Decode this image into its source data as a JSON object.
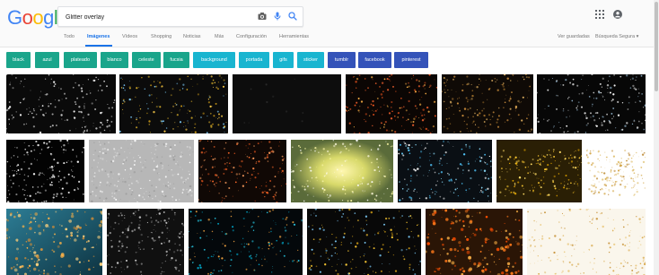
{
  "search": {
    "query": "Glitter overlay"
  },
  "logo": {
    "letters": [
      "G",
      "o",
      "o",
      "g",
      "l",
      "e"
    ],
    "colors": [
      "#4285F4",
      "#EA4335",
      "#FBBC05",
      "#4285F4",
      "#34A853",
      "#EA4335"
    ]
  },
  "tabs": [
    {
      "label": "Todo",
      "active": false
    },
    {
      "label": "Imágenes",
      "active": true
    },
    {
      "label": "Vídeos",
      "active": false
    },
    {
      "label": "Shopping",
      "active": false
    },
    {
      "label": "Noticias",
      "active": false
    },
    {
      "label": "Más",
      "active": false
    },
    {
      "label": "Configuración",
      "active": false
    },
    {
      "label": "Herramientas",
      "active": false
    }
  ],
  "right_tools": {
    "saved": "Ver guardadas",
    "safe": "Búsqueda Segura ▾"
  },
  "chips": [
    {
      "label": "black",
      "color": "#1aa58b"
    },
    {
      "label": "azul",
      "color": "#1aa58b"
    },
    {
      "label": "plateado",
      "color": "#1aa58b"
    },
    {
      "label": "blanco",
      "color": "#1aa58b"
    },
    {
      "label": "celeste",
      "color": "#1aa58b"
    },
    {
      "label": "fucsia",
      "color": "#1aa58b"
    },
    {
      "label": "background",
      "color": "#19b5d0"
    },
    {
      "label": "portada",
      "color": "#19b5d0"
    },
    {
      "label": "gifs",
      "color": "#19b5d0"
    },
    {
      "label": "sticker",
      "color": "#19b5d0"
    },
    {
      "label": "tumblr",
      "color": "#3453b9"
    },
    {
      "label": "facebook",
      "color": "#3453b9"
    },
    {
      "label": "pinterest",
      "color": "#3453b9"
    }
  ],
  "icons": {
    "camera": "camera-icon",
    "mic": "mic-icon",
    "search": "search-icon",
    "apps": "apps-grid-icon",
    "account": "account-icon"
  }
}
